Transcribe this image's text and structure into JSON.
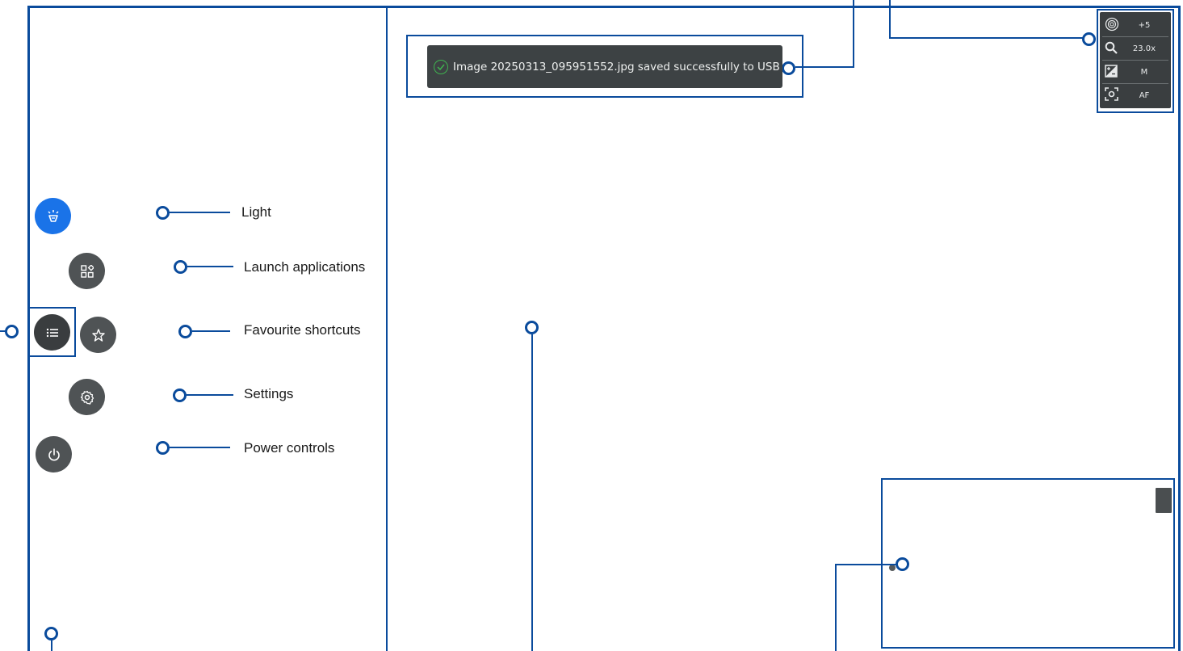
{
  "menu": {
    "light_label": "Light",
    "launch_label": "Launch applications",
    "favourites_label": "Favourite shortcuts",
    "settings_label": "Settings",
    "power_label": "Power controls"
  },
  "toast": {
    "message": "Image 20250313_095951552.jpg saved successfully to USB"
  },
  "status": {
    "exposure_value": "+5",
    "zoom_value": "23.0x",
    "mode_value": "M",
    "focus_value": "AF"
  },
  "colors": {
    "callout_blue": "#0a4b9c",
    "light_active": "#1a73e8",
    "button_gray": "#4f5355",
    "success_green": "#3fb34f"
  }
}
